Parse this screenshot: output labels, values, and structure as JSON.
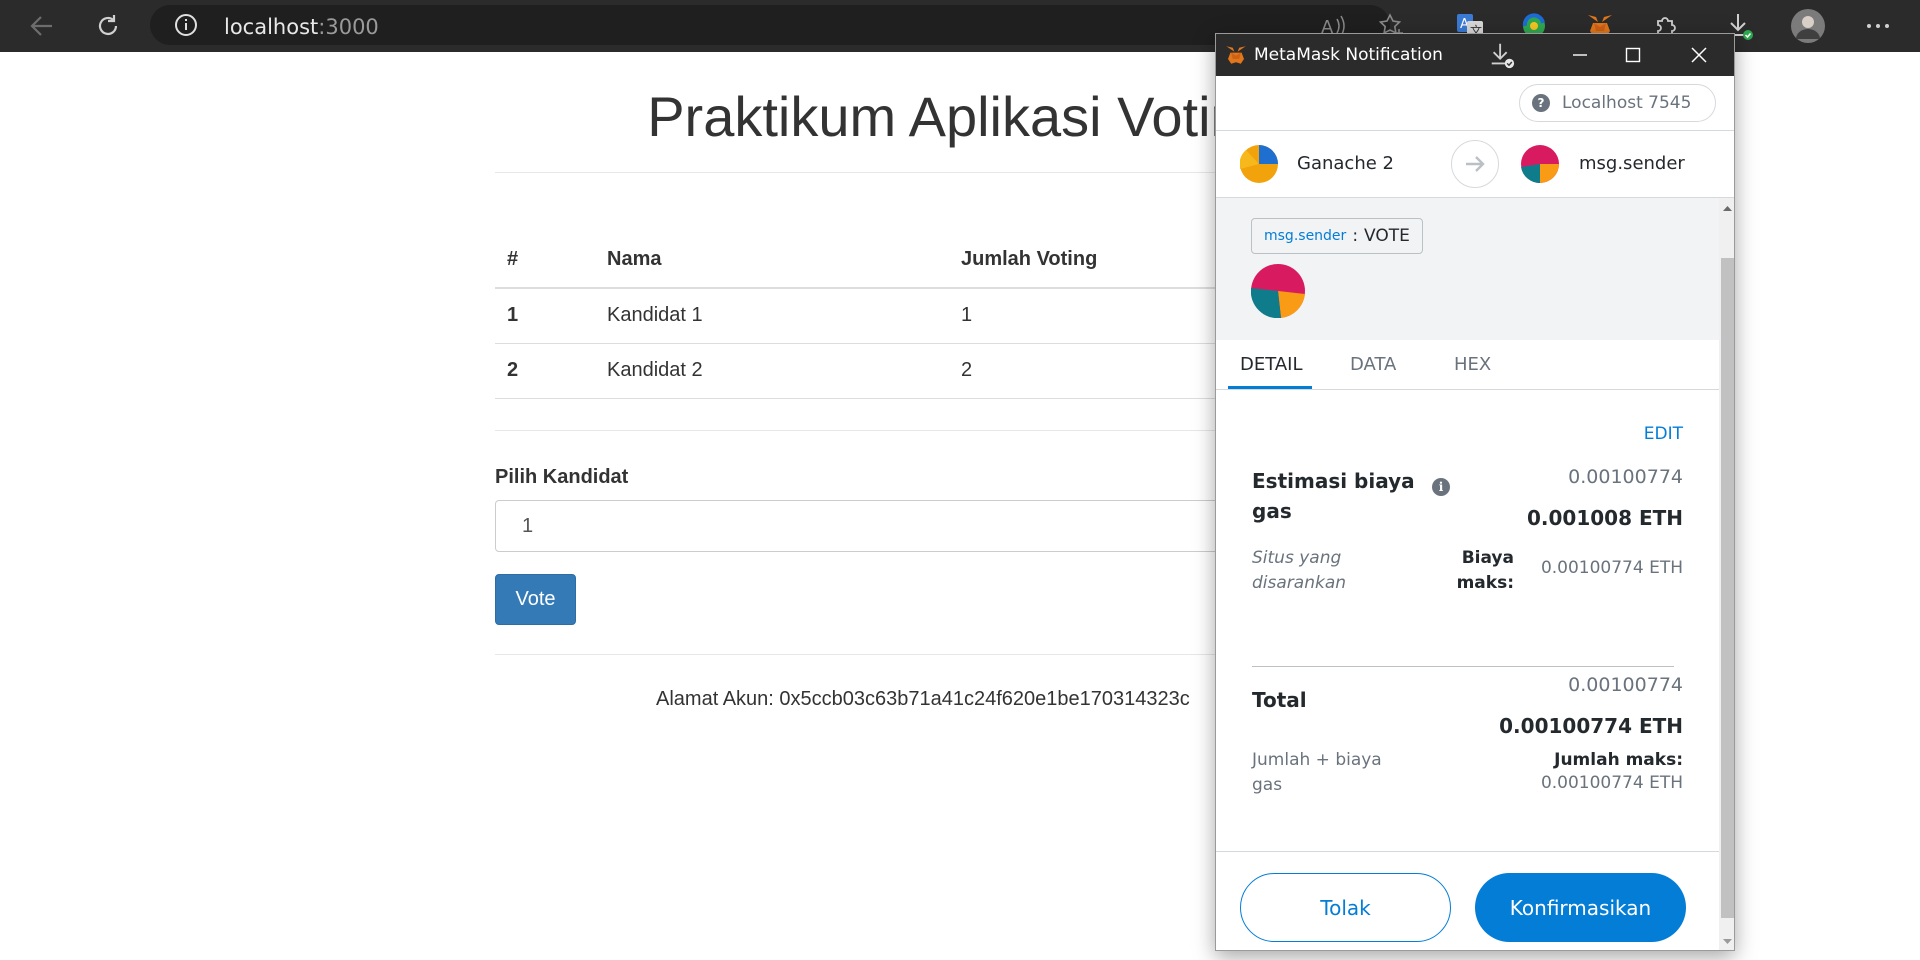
{
  "browser": {
    "url_host": "localhost",
    "url_port": ":3000"
  },
  "page": {
    "title": "Praktikum Aplikasi Voting",
    "table": {
      "headers": [
        "#",
        "Nama",
        "Jumlah Voting"
      ],
      "rows": [
        [
          "1",
          "Kandidat 1",
          "1"
        ],
        [
          "2",
          "Kandidat 2",
          "2"
        ]
      ]
    },
    "select_label": "Pilih Kandidat",
    "select_value": "1",
    "vote_label": "Vote",
    "alamat": "Alamat Akun: 0x5ccb03c63b71a41c24f620e1be170314323c"
  },
  "metamask": {
    "window_title": "MetaMask Notification",
    "network": "Localhost 7545",
    "from_account": "Ganache 2",
    "to_account": "msg.sender",
    "method_contract": "msg.sender",
    "method_sep": ":",
    "method_name": "VOTE",
    "tabs": [
      "DETAIL",
      "DATA",
      "HEX"
    ],
    "edit_label": "EDIT",
    "gas": {
      "label": "Estimasi biaya gas",
      "value_primary": "0.00100774",
      "value_eth": "0.001008 ETH",
      "sub_label": "Situs yang disarankan",
      "max_label": "Biaya maks:",
      "max_value": "0.00100774 ETH"
    },
    "total": {
      "label": "Total",
      "value_primary": "0.00100774",
      "value_eth": "0.00100774 ETH",
      "sub_label": "Jumlah + biaya gas",
      "max_label": "Jumlah maks:",
      "max_value": "0.00100774 ETH"
    },
    "reject_label": "Tolak",
    "confirm_label": "Konfirmasikan"
  },
  "colors": {
    "metamask_blue": "#037dd6",
    "bootstrap_primary": "#337ab7",
    "chrome_dark": "#2b2b2b"
  },
  "icons": [
    "back-icon",
    "refresh-icon",
    "info-icon",
    "read-aloud-icon",
    "favorite-icon",
    "translate-icon",
    "extension-icon",
    "metamask-fox-icon",
    "puzzle-icon",
    "download-icon",
    "profile-avatar",
    "more-icon",
    "minimize-icon",
    "maximize-icon",
    "close-icon",
    "arrow-right-icon"
  ]
}
